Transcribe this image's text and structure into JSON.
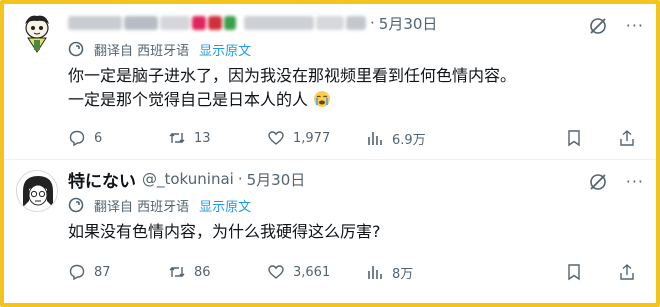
{
  "tweets": [
    {
      "author_name": "",
      "handle": "",
      "date": "5月30日",
      "translation": {
        "label": "翻译自 西班牙语",
        "show_original": "显示原文"
      },
      "text_line1": "你一定是脑子进水了，因为我没在那视频里看到任何色情内容。",
      "text_line2": "一定是那个觉得自己是日本人的人",
      "emoji": "crying-face",
      "stats": {
        "replies": "6",
        "retweets": "13",
        "likes": "1,977",
        "views": "6.9万"
      }
    },
    {
      "author_name": "特にない",
      "handle": "@_tokuninai",
      "date": "5月30日",
      "translation": {
        "label": "翻译自 西班牙语",
        "show_original": "显示原文"
      },
      "text_line1": "如果没有色情内容，为什么我硬得这么厉害?",
      "stats": {
        "replies": "87",
        "retweets": "86",
        "likes": "3,661",
        "views": "8万"
      }
    }
  ],
  "separator": "·",
  "more_label": "···",
  "colors": {
    "accent": "#1d9bf0",
    "muted": "#536471",
    "frame": "#f2c41c"
  }
}
